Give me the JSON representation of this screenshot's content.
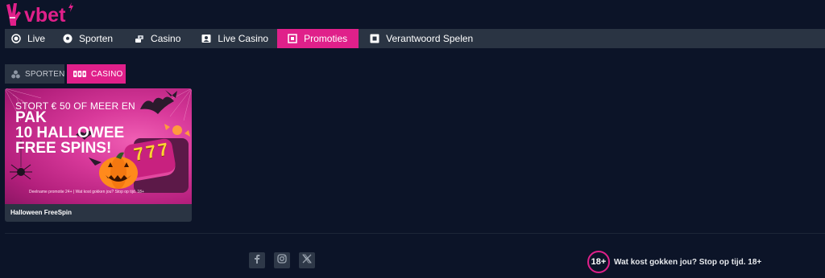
{
  "brand": {
    "logo_text": "vbet",
    "accent": "#e0208a"
  },
  "nav": {
    "items": [
      {
        "label": "Live",
        "icon": "live-dot-icon"
      },
      {
        "label": "Sporten",
        "icon": "soccer-ball-icon"
      },
      {
        "label": "Casino",
        "icon": "casino-chips-icon"
      },
      {
        "label": "Live Casino",
        "icon": "live-dealer-icon"
      },
      {
        "label": "Promoties",
        "icon": "gift-icon",
        "active": true
      },
      {
        "label": "Verantwoord Spelen",
        "icon": "responsible-gaming-icon"
      }
    ]
  },
  "categories": [
    {
      "label": "SPORTEN",
      "icon": "sports-balls-icon"
    },
    {
      "label": "CASINO",
      "icon": "slot-777-icon",
      "active": true
    }
  ],
  "promo": {
    "banner_line1": "STORT € 50 OF MEER EN",
    "banner_line2": "PAK",
    "banner_line3": "10 HALLOWEE",
    "banner_line4": "FREE SPINS!",
    "banner_reels": "777",
    "banner_small": "Deelname promotie 24+ | Wat kost gokken jou? Stop op tijd. 18+",
    "title": "Halloween FreeSpin"
  },
  "footer": {
    "socials": [
      "facebook-icon",
      "instagram-icon",
      "x-icon"
    ],
    "age_badge": "18+",
    "responsible_text": "Wat kost gokken jou? Stop op tijd. 18+"
  }
}
